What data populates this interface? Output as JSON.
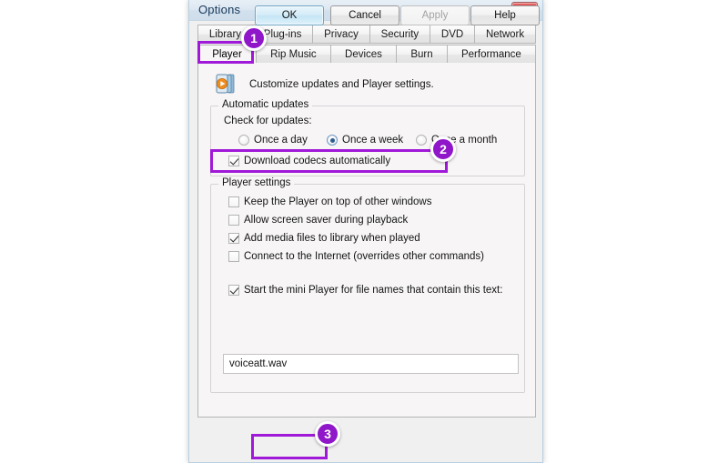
{
  "window": {
    "title": "Options",
    "close_icon": "close-icon"
  },
  "tabs": {
    "row1": [
      {
        "label": "Library",
        "selected": false
      },
      {
        "label": "Plug-ins",
        "selected": false
      },
      {
        "label": "Privacy",
        "selected": false
      },
      {
        "label": "Security",
        "selected": false
      },
      {
        "label": "DVD",
        "selected": false
      },
      {
        "label": "Network",
        "selected": false
      }
    ],
    "row2": [
      {
        "label": "Player",
        "selected": true
      },
      {
        "label": "Rip Music",
        "selected": false
      },
      {
        "label": "Devices",
        "selected": false
      },
      {
        "label": "Burn",
        "selected": false
      },
      {
        "label": "Performance",
        "selected": false
      }
    ]
  },
  "panel": {
    "header_text": "Customize updates and Player settings.",
    "header_icon": "media-player-icon",
    "automatic_updates": {
      "group_title": "Automatic updates",
      "check_label": "Check for updates:",
      "radios": [
        {
          "label": "Once a day",
          "checked": false
        },
        {
          "label": "Once a week",
          "checked": true
        },
        {
          "label": "Once a month",
          "checked": false
        }
      ],
      "download_codecs": {
        "label": "Download codecs automatically",
        "checked": true
      }
    },
    "player_settings": {
      "group_title": "Player settings",
      "checkboxes": [
        {
          "label": "Keep the Player on top of other windows",
          "checked": false
        },
        {
          "label": "Allow screen saver during playback",
          "checked": false
        },
        {
          "label": "Add media files to library when played",
          "checked": true
        },
        {
          "label": "Connect to the Internet (overrides other commands)",
          "checked": false
        },
        {
          "label": "Start the mini Player for file names that contain this text:",
          "checked": true
        }
      ],
      "mini_player_text": {
        "value": "voiceatt.wav",
        "placeholder": ""
      }
    }
  },
  "footer": {
    "ok": "OK",
    "cancel": "Cancel",
    "apply": "Apply",
    "help": "Help"
  },
  "annotations": {
    "highlight_color": "#a019d8",
    "badge_color": "#8f16c9",
    "badges": [
      {
        "number": "1",
        "target": "player-tab"
      },
      {
        "number": "2",
        "target": "download-codecs-checkbox"
      },
      {
        "number": "3",
        "target": "ok-button"
      }
    ]
  }
}
